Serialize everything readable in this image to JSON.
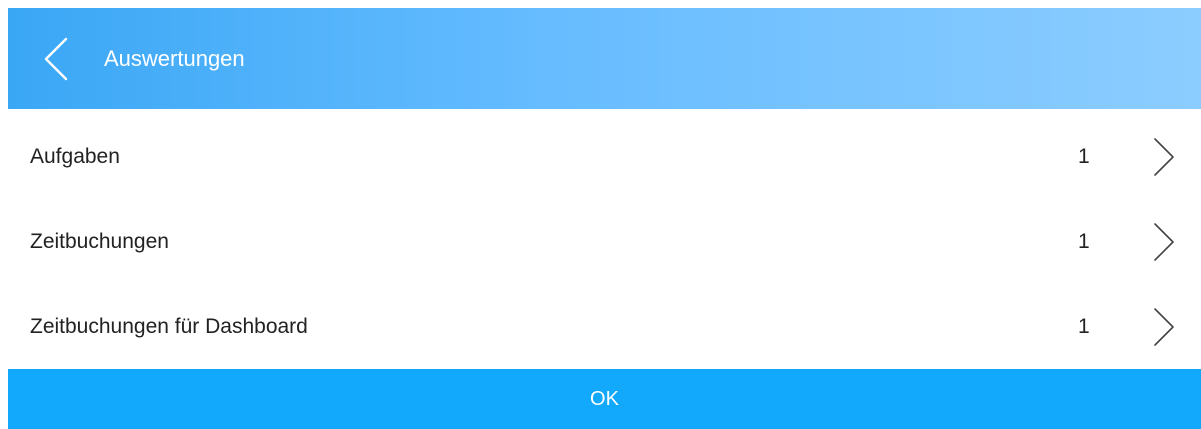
{
  "header": {
    "back_icon": "chevron-left-icon",
    "title": "Auswertungen",
    "gradient": [
      "#3aa7f5",
      "#8ccdff"
    ]
  },
  "list": {
    "items": [
      {
        "label": "Aufgaben",
        "count": "1",
        "icon": "chevron-right-icon"
      },
      {
        "label": "Zeitbuchungen",
        "count": "1",
        "icon": "chevron-right-icon"
      },
      {
        "label": "Zeitbuchungen für Dashboard",
        "count": "1",
        "icon": "chevron-right-icon"
      }
    ]
  },
  "footer": {
    "ok_label": "OK",
    "color": "#12a8fb"
  }
}
